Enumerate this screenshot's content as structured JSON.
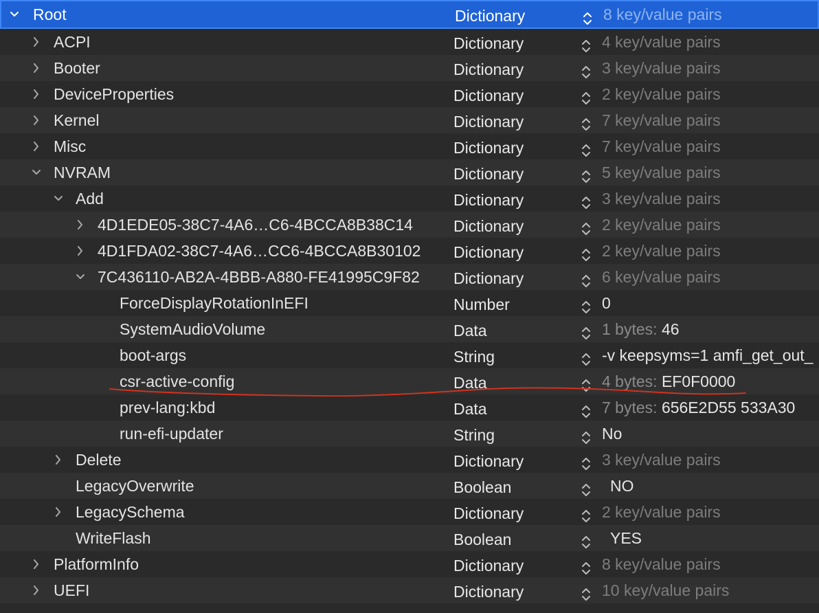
{
  "rows": [
    {
      "key": "Root",
      "type": "Dictionary",
      "value": "8 key/value pairs",
      "disclosure": "expanded",
      "value_style": "muted"
    },
    {
      "key": "ACPI",
      "type": "Dictionary",
      "value": "4 key/value pairs",
      "disclosure": "collapsed",
      "value_style": "muted"
    },
    {
      "key": "Booter",
      "type": "Dictionary",
      "value": "3 key/value pairs",
      "disclosure": "collapsed",
      "value_style": "muted"
    },
    {
      "key": "DeviceProperties",
      "type": "Dictionary",
      "value": "2 key/value pairs",
      "disclosure": "collapsed",
      "value_style": "muted"
    },
    {
      "key": "Kernel",
      "type": "Dictionary",
      "value": "7 key/value pairs",
      "disclosure": "collapsed",
      "value_style": "muted"
    },
    {
      "key": "Misc",
      "type": "Dictionary",
      "value": "7 key/value pairs",
      "disclosure": "collapsed",
      "value_style": "muted"
    },
    {
      "key": "NVRAM",
      "type": "Dictionary",
      "value": "5 key/value pairs",
      "disclosure": "expanded",
      "value_style": "muted"
    },
    {
      "key": "Add",
      "type": "Dictionary",
      "value": "3 key/value pairs",
      "disclosure": "expanded",
      "value_style": "muted"
    },
    {
      "key": "4D1EDE05-38C7-4A6…C6-4BCCA8B38C14",
      "type": "Dictionary",
      "value": "2 key/value pairs",
      "disclosure": "collapsed",
      "value_style": "muted"
    },
    {
      "key": "4D1FDA02-38C7-4A6…CC6-4BCCA8B30102",
      "type": "Dictionary",
      "value": "2 key/value pairs",
      "disclosure": "collapsed",
      "value_style": "muted"
    },
    {
      "key": "7C436110-AB2A-4BBB-A880-FE41995C9F82",
      "type": "Dictionary",
      "value": "6 key/value pairs",
      "disclosure": "expanded",
      "value_style": "muted"
    },
    {
      "key": "ForceDisplayRotationInEFI",
      "type": "Number",
      "value": "0",
      "disclosure": "none",
      "value_style": "normal"
    },
    {
      "key": "SystemAudioVolume",
      "type": "Data",
      "value_prefix": "1 bytes: ",
      "value": "46",
      "disclosure": "none",
      "value_style": "data"
    },
    {
      "key": "boot-args",
      "type": "String",
      "value": "-v keepsyms=1 amfi_get_out_",
      "disclosure": "none",
      "value_style": "normal"
    },
    {
      "key": "csr-active-config",
      "type": "Data",
      "value_prefix": "4 bytes: ",
      "value": "EF0F0000",
      "disclosure": "none",
      "value_style": "data"
    },
    {
      "key": "prev-lang:kbd",
      "type": "Data",
      "value_prefix": "7 bytes: ",
      "value": "656E2D55 533A30",
      "disclosure": "none",
      "value_style": "data"
    },
    {
      "key": "run-efi-updater",
      "type": "String",
      "value": "No",
      "disclosure": "none",
      "value_style": "normal"
    },
    {
      "key": "Delete",
      "type": "Dictionary",
      "value": "3 key/value pairs",
      "disclosure": "collapsed",
      "value_style": "muted"
    },
    {
      "key": "LegacyOverwrite",
      "type": "Boolean",
      "value": "NO",
      "disclosure": "none",
      "value_style": "bool"
    },
    {
      "key": "LegacySchema",
      "type": "Dictionary",
      "value": "2 key/value pairs",
      "disclosure": "collapsed",
      "value_style": "muted"
    },
    {
      "key": "WriteFlash",
      "type": "Boolean",
      "value": "YES",
      "disclosure": "none",
      "value_style": "bool"
    },
    {
      "key": "PlatformInfo",
      "type": "Dictionary",
      "value": "8 key/value pairs",
      "disclosure": "collapsed",
      "value_style": "muted"
    },
    {
      "key": "UEFI",
      "type": "Dictionary",
      "value": "10 key/value pairs",
      "disclosure": "collapsed",
      "value_style": "muted"
    }
  ],
  "selected_row": "Root",
  "annotation": {
    "kind": "red-underline",
    "under_row": "csr-active-config",
    "color": "#d0321e"
  },
  "colors": {
    "selection": "#1f62d6",
    "background": "#2a2a2a",
    "muted_text": "#7d7d7d"
  }
}
